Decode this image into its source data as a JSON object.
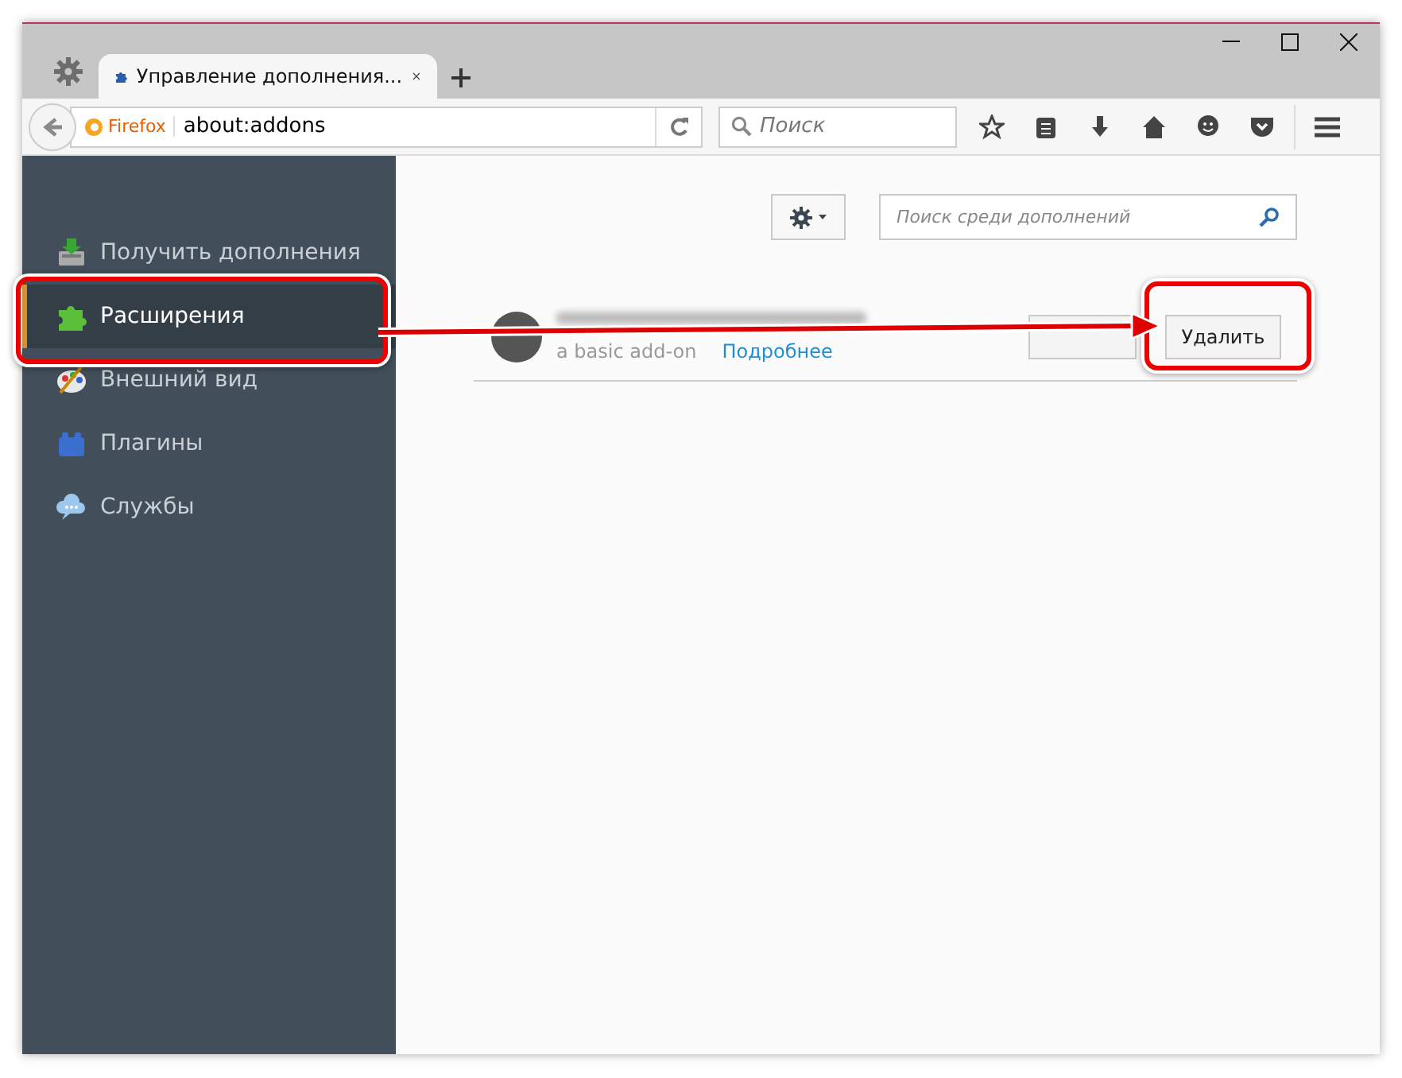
{
  "tab": {
    "title": "Управление дополнения...",
    "selected": true
  },
  "address": {
    "identity": "Firefox",
    "url": "about:addons"
  },
  "search": {
    "placeholder": "Поиск"
  },
  "sidebar": {
    "items": [
      {
        "label": "Получить дополнения",
        "kind": "get",
        "selected": false
      },
      {
        "label": "Расширения",
        "kind": "extensions",
        "selected": true
      },
      {
        "label": "Внешний вид",
        "kind": "appearance",
        "selected": false
      },
      {
        "label": "Плагины",
        "kind": "plugins",
        "selected": false
      },
      {
        "label": "Службы",
        "kind": "services",
        "selected": false
      }
    ]
  },
  "addons_search": {
    "placeholder": "Поиск среди дополнений"
  },
  "addon": {
    "description": "a basic add-on",
    "more_link": "Подробнее",
    "remove_button": "Удалить"
  }
}
